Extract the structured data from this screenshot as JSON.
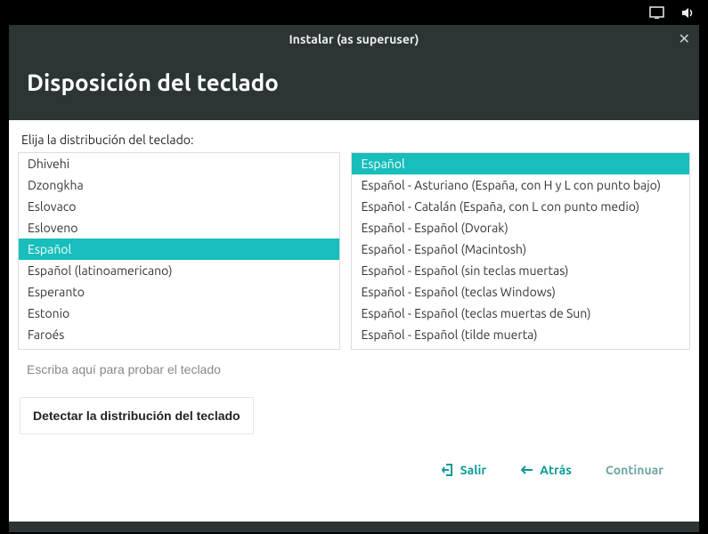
{
  "topbar": {
    "icons": [
      "display",
      "volume"
    ]
  },
  "window": {
    "title": "Instalar (as superuser)",
    "header": "Disposición del teclado",
    "prompt": "Elija la distribución del teclado:",
    "left_list": [
      {
        "label": "Dhivehi",
        "selected": false
      },
      {
        "label": "Dzongkha",
        "selected": false
      },
      {
        "label": "Eslovaco",
        "selected": false
      },
      {
        "label": "Esloveno",
        "selected": false
      },
      {
        "label": "Español",
        "selected": true
      },
      {
        "label": "Español (latinoamericano)",
        "selected": false
      },
      {
        "label": "Esperanto",
        "selected": false
      },
      {
        "label": "Estonio",
        "selected": false
      },
      {
        "label": "Faroés",
        "selected": false
      }
    ],
    "right_list": [
      {
        "label": "Español",
        "selected": true
      },
      {
        "label": "Español - Asturiano (España, con H y L con punto bajo)",
        "selected": false
      },
      {
        "label": "Español - Catalán (España, con L con punto medio)",
        "selected": false
      },
      {
        "label": "Español - Español (Dvorak)",
        "selected": false
      },
      {
        "label": "Español - Español (Macintosh)",
        "selected": false
      },
      {
        "label": "Español - Español (sin teclas muertas)",
        "selected": false
      },
      {
        "label": "Español - Español (teclas Windows)",
        "selected": false
      },
      {
        "label": "Español - Español (teclas muertas de Sun)",
        "selected": false
      },
      {
        "label": "Español - Español (tilde muerta)",
        "selected": false
      }
    ],
    "test_placeholder": "Escriba aquí para probar el teclado",
    "detect_button": "Detectar la distribución del teclado"
  },
  "footer": {
    "exit": "Salir",
    "back": "Atrás",
    "continue": "Continuar"
  }
}
